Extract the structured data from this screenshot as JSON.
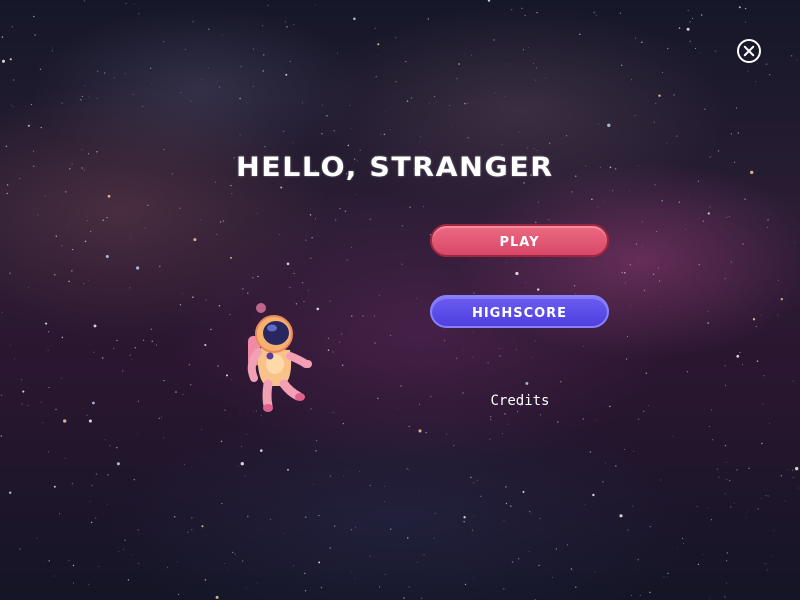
{
  "title": "HELLO, STRANGER",
  "buttons": {
    "play_label": "PLAY",
    "highscore_label": "HIGHSCORE",
    "credits_label": "Credits"
  },
  "icons": {
    "close": "close-icon",
    "character": "astronaut"
  },
  "colors": {
    "play": "#e05a74",
    "highscore": "#5b4ce8",
    "text": "#ffffff"
  }
}
